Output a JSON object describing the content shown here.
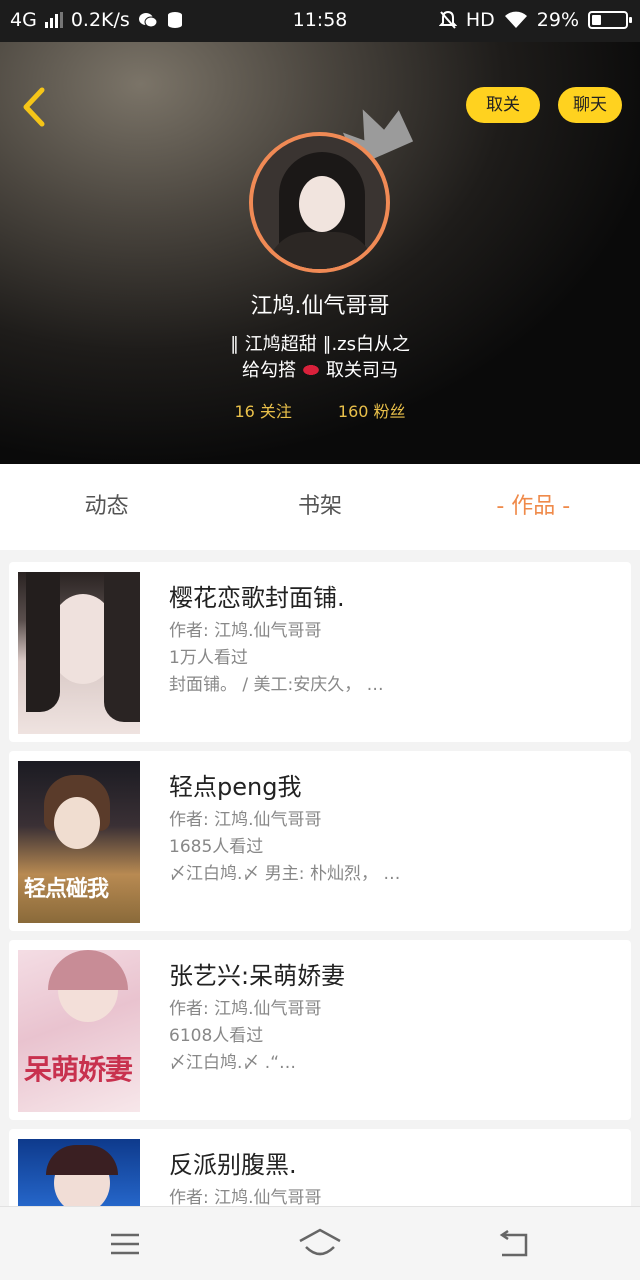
{
  "status_bar": {
    "network": "4G",
    "speed": "0.2K/s",
    "time": "11:58",
    "hd": "HD",
    "battery": "29%",
    "battery_level": 0.29
  },
  "header": {
    "username": "江鸠.仙气哥哥",
    "bio_line1": "∥ 江鸠超甜 ∥.zs白从之",
    "bio_line2_a": "给勾搭",
    "bio_line2_b": "取关司马",
    "following": "16 关注",
    "followers": "160 粉丝",
    "unfollow_label": "取关",
    "chat_label": "聊天"
  },
  "tabs": [
    {
      "label": "动态"
    },
    {
      "label": "书架"
    },
    {
      "label": "- 作品 -"
    }
  ],
  "works": [
    {
      "title": "樱花恋歌封面铺.",
      "author": "作者: 江鸠.仙气哥哥",
      "views": "1万人看过",
      "desc": "封面铺。 / 美工:安庆久， …",
      "cover_text": ""
    },
    {
      "title": "轻点peng我",
      "author": "作者: 江鸠.仙气哥哥",
      "views": "1685人看过",
      "desc": "〆江白鸠.〆 男主: 朴灿烈， …",
      "cover_text": "轻点碰我"
    },
    {
      "title": "张艺兴:呆萌娇妻",
      "author": "作者: 江鸠.仙气哥哥",
      "views": "6108人看过",
      "desc": "〆江白鸠.〆 .“…",
      "cover_text": "呆萌娇妻"
    },
    {
      "title": "反派别腹黑.",
      "author": "作者: 江鸠.仙气哥哥",
      "views": "",
      "desc": "",
      "cover_text": ""
    }
  ],
  "icons": {
    "back": "chevron-left-icon",
    "crown": "crown-icon",
    "menu": "menu-icon",
    "home": "home-icon",
    "return": "back-icon"
  },
  "colors": {
    "accent_yellow": "#ffd21f",
    "accent_orange": "#ef8a4a",
    "stats_gold": "#e9c04a"
  }
}
